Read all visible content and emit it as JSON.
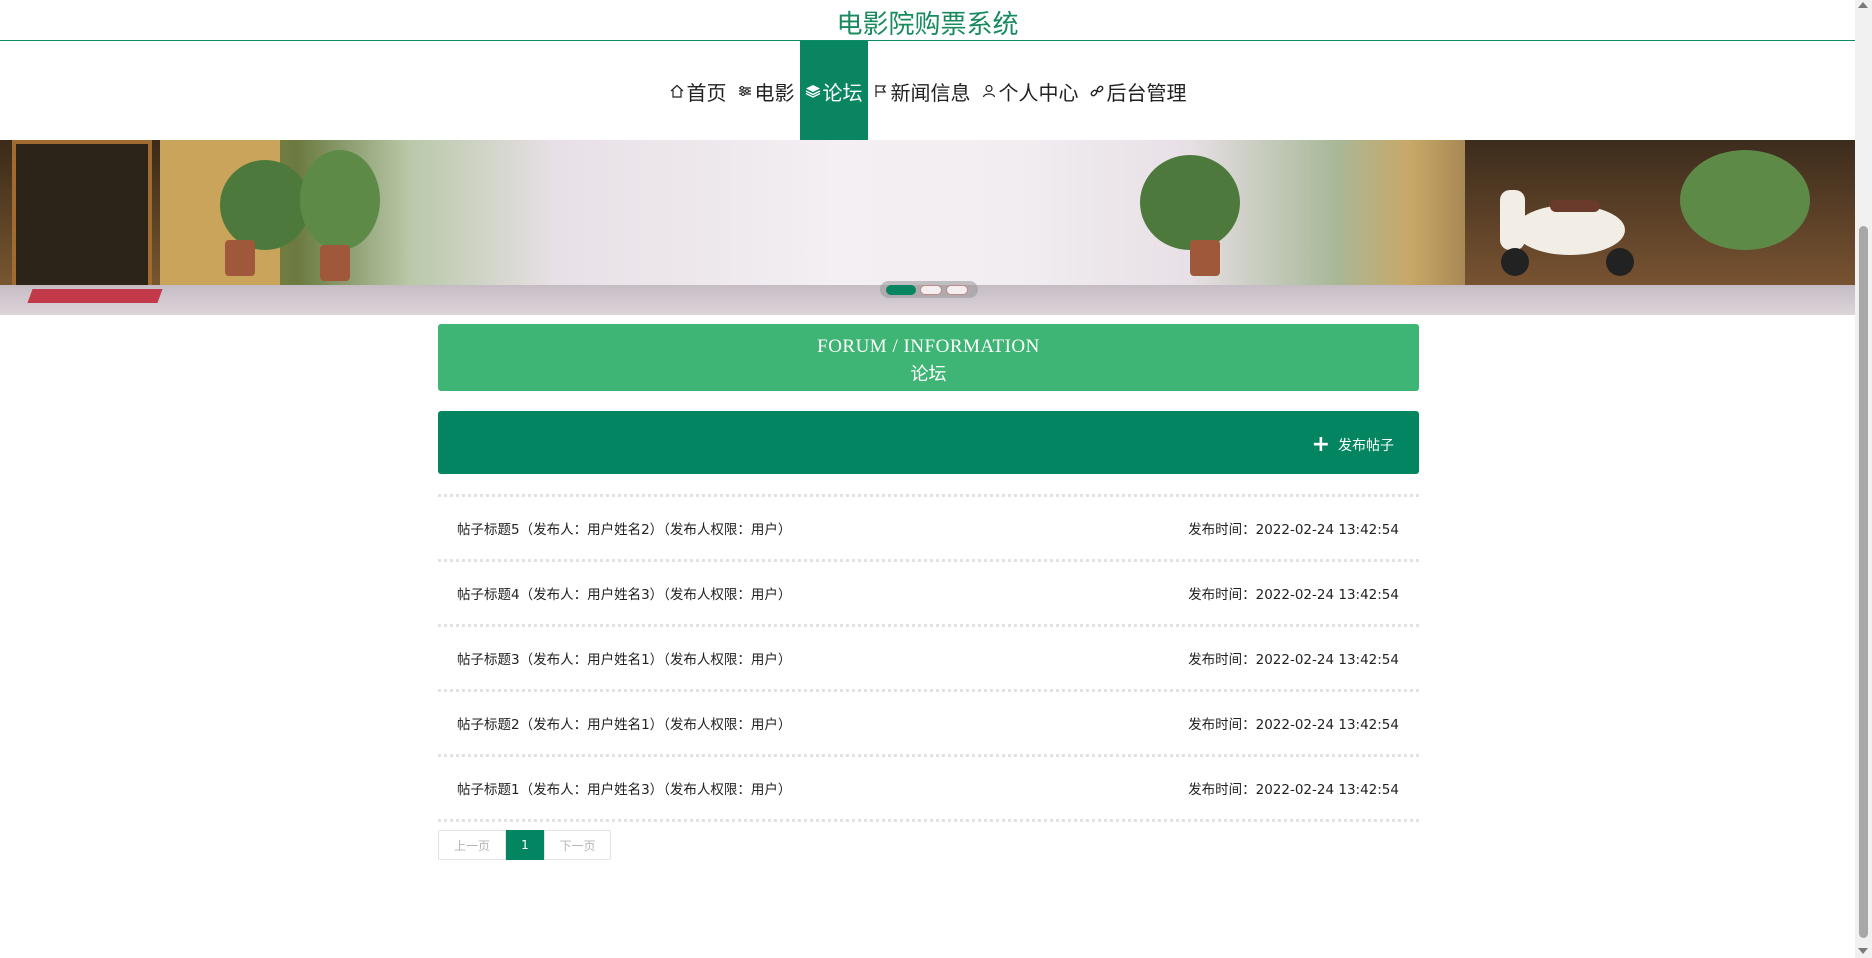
{
  "header": {
    "title": "电影院购票系统"
  },
  "nav": {
    "items": [
      {
        "label": "首页",
        "icon": "home-icon"
      },
      {
        "label": "电影",
        "icon": "sliders-icon"
      },
      {
        "label": "论坛",
        "icon": "layers-icon",
        "active": true
      },
      {
        "label": "新闻信息",
        "icon": "flag-icon"
      },
      {
        "label": "个人中心",
        "icon": "user-icon"
      },
      {
        "label": "后台管理",
        "icon": "link-icon"
      }
    ]
  },
  "banner": {
    "active_slide": 1,
    "slide_count": 3
  },
  "section": {
    "title_en": "FORUM / INFORMATION",
    "title_cn": "论坛"
  },
  "toolbar": {
    "publish_label": "发布帖子",
    "publish_icon": "plus-icon"
  },
  "posts": [
    {
      "title": "帖子标题5（发布人：用户姓名2）（发布人权限：用户）",
      "time": "发布时间：2022-02-24 13:42:54"
    },
    {
      "title": "帖子标题4（发布人：用户姓名3）（发布人权限：用户）",
      "time": "发布时间：2022-02-24 13:42:54"
    },
    {
      "title": "帖子标题3（发布人：用户姓名1）（发布人权限：用户）",
      "time": "发布时间：2022-02-24 13:42:54"
    },
    {
      "title": "帖子标题2（发布人：用户姓名1）（发布人权限：用户）",
      "time": "发布时间：2022-02-24 13:42:54"
    },
    {
      "title": "帖子标题1（发布人：用户姓名3）（发布人权限：用户）",
      "time": "发布时间：2022-02-24 13:42:54"
    }
  ],
  "pager": {
    "prev": "上一页",
    "current": "1",
    "next": "下一页"
  },
  "colors": {
    "primary": "#048561",
    "section_head": "#3eb574",
    "title": "#188a5e"
  }
}
